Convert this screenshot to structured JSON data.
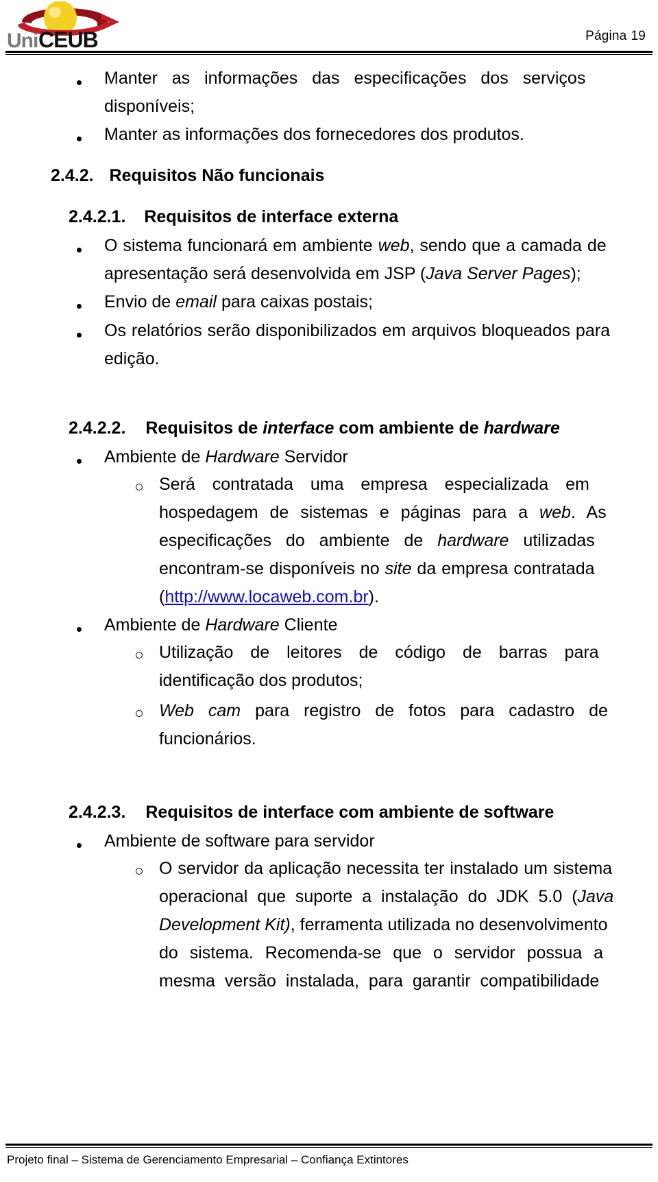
{
  "header": {
    "logo_alt": "UniCEUB",
    "logo_text_light": "Uni",
    "logo_text_bold": "CEUB",
    "page_label": "Página",
    "page_number": "19"
  },
  "footer": {
    "text": "Projeto final – Sistema de Gerenciamento Empresarial – Confiança Extintores"
  },
  "colors": {
    "link": "#1111bb",
    "text": "#000000",
    "logo_sphere": "#f2d024",
    "logo_swoosh": "#c01f2a",
    "logo_uni": "#7a7a7a",
    "logo_ceub": "#111111"
  },
  "content": {
    "bullets_top": [
      {
        "marker": "bullet",
        "lines": [
          "Manter as informações das especificações dos serviços",
          "disponíveis;"
        ]
      },
      {
        "marker": "bullet",
        "lines": [
          "Manter as informações dos fornecedores dos produtos."
        ]
      }
    ],
    "heading_242": {
      "number": "2.4.2.",
      "title": "Requisitos Não funcionais"
    },
    "heading_2421": {
      "number": "2.4.2.1.",
      "title": "Requisitos de interface externa"
    },
    "bullets_2421": [
      {
        "marker": "bullet",
        "line1_a": "O sistema funcionará em ambiente ",
        "line1_i": "web",
        "line1_b": ", sendo que a camada de",
        "line2_a": "apresentação será desenvolvida em JSP (",
        "line2_i": "Java Server Pages",
        "line2_b": ");"
      },
      {
        "marker": "bullet",
        "line1_a": "Envio de ",
        "line1_i": "email",
        "line1_b": " para caixas postais;"
      },
      {
        "marker": "bullet",
        "line1_a": "Os relatórios serão disponibilizados em arquivos bloqueados para",
        "line2_a": "edição."
      }
    ],
    "heading_2422": {
      "number": "2.4.2.2.",
      "title_a": "Requisitos de ",
      "title_i1": "interface",
      "title_b": " com ambiente de ",
      "title_i2": "hardware"
    },
    "hw_servidor": {
      "marker": "bullet",
      "label_a": "Ambiente de ",
      "label_i": "Hardware",
      "label_b": " Servidor",
      "sub": [
        {
          "marker": "circle",
          "l1": "Será contratada uma empresa especializada em",
          "l2_a": "hospedagem de sistemas e páginas para a ",
          "l2_i": "web",
          "l2_b": ". As",
          "l3_a": "especificações do ambiente de ",
          "l3_i": "hardware",
          "l3_b": " utilizadas",
          "l4_a": "encontram-se disponíveis no ",
          "l4_i": "site",
          "l4_b": " da empresa contratada",
          "l5_open": "(",
          "l5_link": "http://www.locaweb.com.br",
          "l5_close": ")."
        }
      ]
    },
    "hw_cliente": {
      "marker": "bullet",
      "label_a": "Ambiente de ",
      "label_i": "Hardware",
      "label_b": " Cliente",
      "sub": [
        {
          "marker": "circle",
          "l1": "Utilização de leitores de código de barras para",
          "l2": "identificação dos produtos;"
        },
        {
          "marker": "circle",
          "l1_i": "Web cam",
          "l1_b": " para registro de fotos para cadastro de",
          "l2": "funcionários."
        }
      ]
    },
    "heading_2423": {
      "number": "2.4.2.3.",
      "title": "Requisitos de interface com ambiente de software"
    },
    "sw_servidor": {
      "marker": "bullet",
      "label": "Ambiente de software para servidor",
      "sub": [
        {
          "marker": "circle",
          "l1": "O servidor da aplicação necessita ter instalado um sistema",
          "l2_a": "operacional que suporte a instalação do JDK 5.0 (",
          "l2_i": "Java",
          "l3_i": "Development Kit)",
          "l3_b": ", ferramenta utilizada no desenvolvimento",
          "l4": "do sistema. Recomenda-se que o servidor possua a",
          "l5": "mesma versão instalada, para garantir compatibilidade"
        }
      ]
    }
  }
}
